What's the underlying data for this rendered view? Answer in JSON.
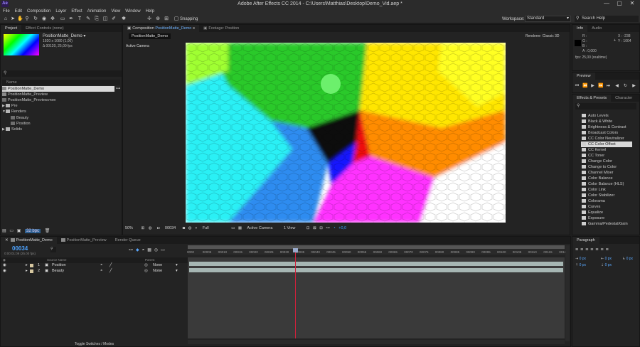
{
  "window": {
    "title": "Adobe After Effects CC 2014 - C:\\Users\\Matthias\\Desktop\\Demo_Vid.aep *",
    "logo": "Ae",
    "minimize": "—",
    "maximize": "▢",
    "close": "✕"
  },
  "menu": [
    "File",
    "Edit",
    "Composition",
    "Layer",
    "Effect",
    "Animation",
    "View",
    "Window",
    "Help"
  ],
  "toolbar": {
    "snapping_label": "Snapping",
    "workspace_label": "Workspace:",
    "workspace_value": "Standard",
    "search_help": "Search Help"
  },
  "project_panel": {
    "tabs": [
      "Project",
      "Effect Controls (none)"
    ],
    "selected_name": "PositionMatte_Demo ▾",
    "selected_info_1": "1920 x 1080 (1,00)",
    "selected_info_2": "Δ 00120, 25,00 fps",
    "search_placeholder": "",
    "column_header": "Name",
    "items": [
      {
        "name": "PositionMatte_Demo",
        "type": "comp",
        "selected": true
      },
      {
        "name": "PositionMatte_Preview",
        "type": "comp"
      },
      {
        "name": "PositionMatte_Preview.mov",
        "type": "footage"
      },
      {
        "name": "Pre",
        "type": "folder"
      },
      {
        "name": "Renders",
        "type": "folder-open"
      },
      {
        "name": "Beauty",
        "type": "footage",
        "indent": true
      },
      {
        "name": "Position",
        "type": "footage",
        "indent": true
      },
      {
        "name": "Solids",
        "type": "folder"
      }
    ],
    "bpc": "32 bpc"
  },
  "comp_panel": {
    "tab_prefix": "Composition",
    "tab_comp": "PositionMatte_Demo",
    "tab_footage": "Footage: Position",
    "subtab": "PositionMatte_Demo",
    "renderer_label": "Renderer:",
    "renderer_value": "Classic 3D",
    "active_camera": "Active Camera",
    "zoom": "50%",
    "timecode": "00034",
    "resolution": "Full",
    "camera_view": "Active Camera",
    "views": "1 View",
    "exposure": "+0,0"
  },
  "info_panel": {
    "tabs": [
      "Info",
      "Audio"
    ],
    "r": "R :",
    "g": "G :",
    "b": "B :",
    "a": "A : 0,000",
    "x": "X : -238",
    "y": "Y : 1004",
    "fps": "fps: 25,00 (realtime)"
  },
  "preview_panel": {
    "tab": "Preview"
  },
  "effects_panel": {
    "tabs": [
      "Effects & Presets",
      "Character"
    ],
    "items": [
      "Auto Levels",
      "Black & White",
      "Brightness & Contrast",
      "Broadcast Colors",
      "CC Color Neutralizer",
      "CC Color Offset",
      "CC Kernel",
      "CC Toner",
      "Change Color",
      "Change to Color",
      "Channel Mixer",
      "Color Balance",
      "Color Balance (HLS)",
      "Color Link",
      "Color Stabilizer",
      "Colorama",
      "Curves",
      "Equalize",
      "Exposure",
      "Gamma/Pedestal/Gain"
    ],
    "selected_index": 5
  },
  "paragraph_panel": {
    "tab": "Paragraph",
    "px1": "0 px",
    "px2": "0 px",
    "px3": "0 px",
    "px4": "0 px",
    "px5": "0 px"
  },
  "timeline": {
    "tabs": [
      "PositionMatte_Demo",
      "PositionMatte_Preview",
      "Render Queue"
    ],
    "timecode": "00034",
    "timecode_sub": "0:00:01:09 (25.00 fps)",
    "col_source": "Source Name",
    "col_parent": "Parent",
    "layers": [
      {
        "num": "1",
        "name": "Position",
        "parent": "None"
      },
      {
        "num": "2",
        "name": "Beauty",
        "parent": "None"
      }
    ],
    "ruler": [
      "0000",
      "00005",
      "00010",
      "00015",
      "00020",
      "00025",
      "00030",
      "00035",
      "00040",
      "00045",
      "00050",
      "00055",
      "00060",
      "00065",
      "00070",
      "00075",
      "00080",
      "00085",
      "00090",
      "00095",
      "00100",
      "00105",
      "00110",
      "00115",
      "0012"
    ],
    "toggle_label": "Toggle Switches / Modes"
  },
  "colors": {
    "accent_blue": "#2d8ceb",
    "playhead": "#d0213b",
    "layer_bar": "#a6b6b3"
  }
}
